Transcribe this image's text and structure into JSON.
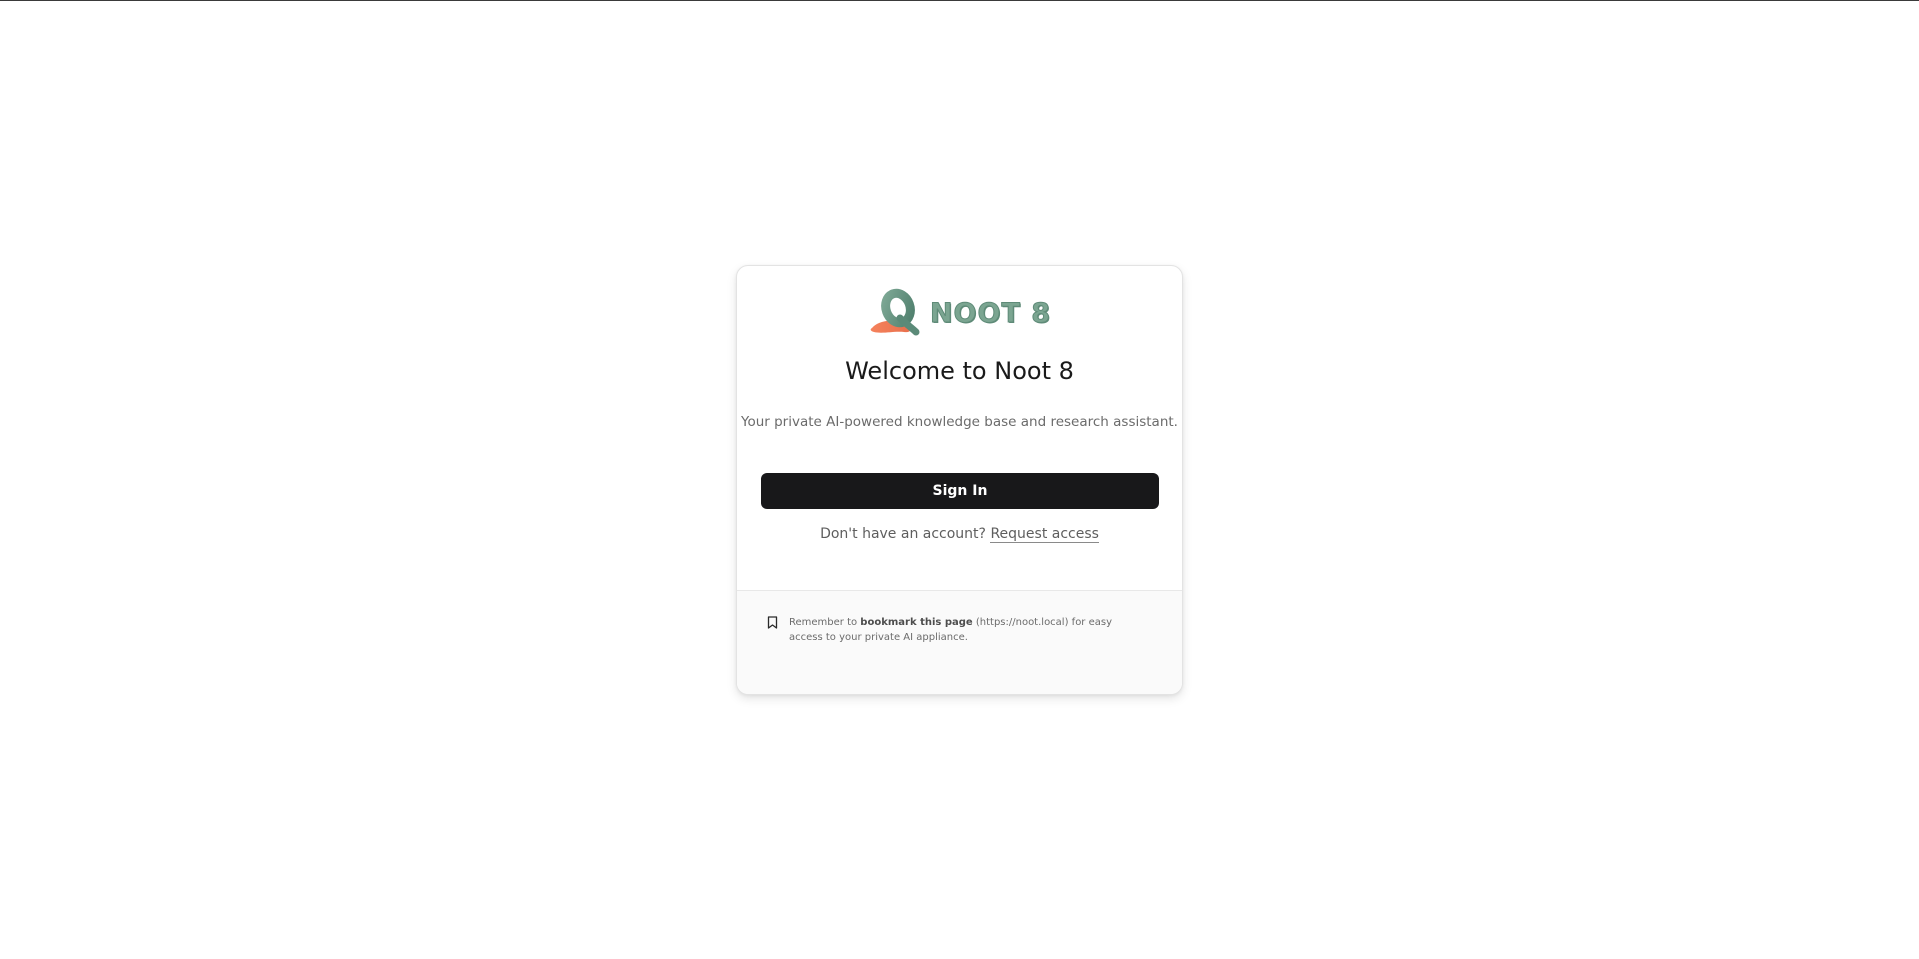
{
  "brand": {
    "logo_text": "NOOT 8",
    "logo_colors": {
      "teal": "#6f9e8a",
      "orange": "#f07a55"
    }
  },
  "login": {
    "title": "Welcome to Noot 8",
    "subtitle": "Your private AI-powered knowledge base and research assistant.",
    "signin_label": "Sign In",
    "no_account_text": "Don't have an account?",
    "request_access_label": "Request access"
  },
  "footer": {
    "icon": "bookmark-icon",
    "text_before": "Remember to ",
    "text_bold": "bookmark this page",
    "text_after": " (https://noot.local) for easy access to your private AI appliance."
  },
  "colors": {
    "button_bg": "#18181a",
    "text_muted": "#6b6b6b",
    "background": "#ffffff"
  }
}
